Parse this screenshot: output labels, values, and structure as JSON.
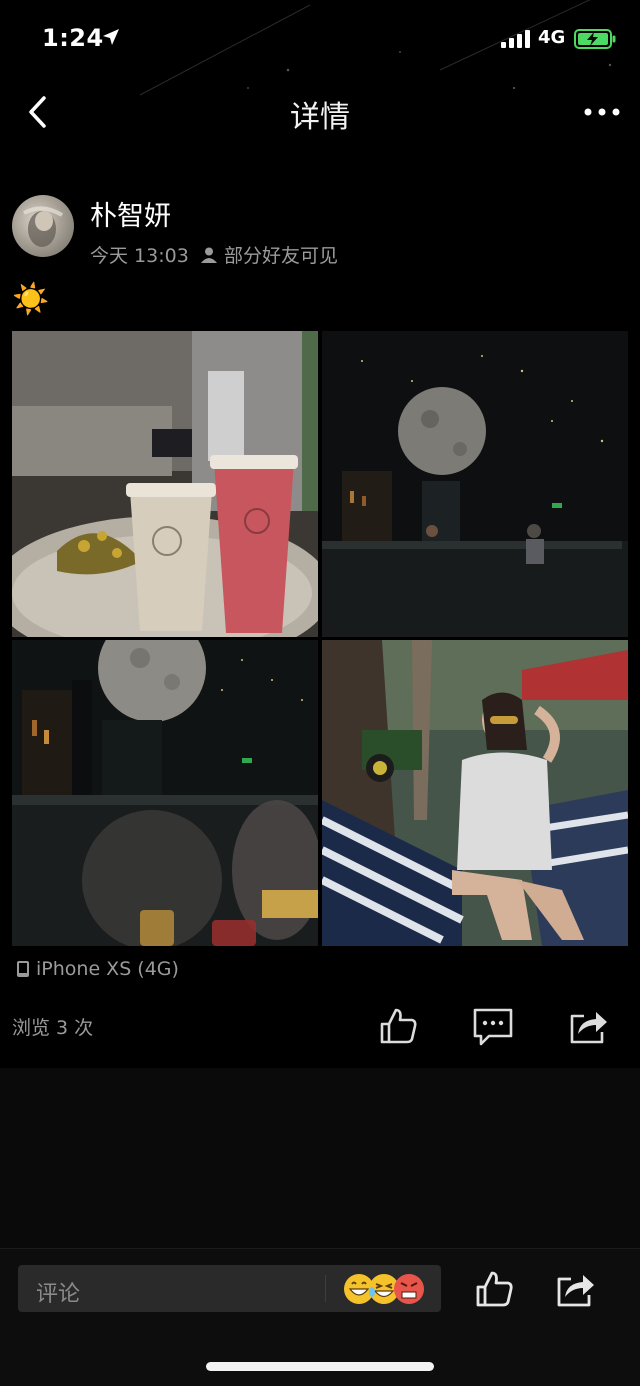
{
  "status_bar": {
    "time": "1:24",
    "network": "4G",
    "icons": [
      "location-arrow-icon",
      "signal-icon",
      "battery-charging-icon"
    ]
  },
  "nav": {
    "title": "详情",
    "icons": [
      "back-chevron-icon",
      "more-dots-icon"
    ]
  },
  "post": {
    "author": "朴智妍",
    "time": "今天 13:03",
    "visibility": "部分好友可见",
    "text": "☀️",
    "photos": [
      "drinks-on-table-photo",
      "moon-bar-photo",
      "moon-bar-people-photo",
      "beach-woman-photo"
    ],
    "device": "iPhone XS (4G)",
    "views": "浏览 3 次"
  },
  "actions": {
    "icons": [
      "thumbs-up-icon",
      "comment-icon",
      "share-icon"
    ]
  },
  "comment_bar": {
    "placeholder": "评论",
    "emoji_icons": [
      "grin-emoji",
      "laugh-cry-emoji",
      "angry-emoji"
    ]
  },
  "colors": {
    "background": "#000000",
    "secondary_text": "#9a9a9a",
    "input_background": "#2a2a2a",
    "battery_green": "#4cd964"
  }
}
